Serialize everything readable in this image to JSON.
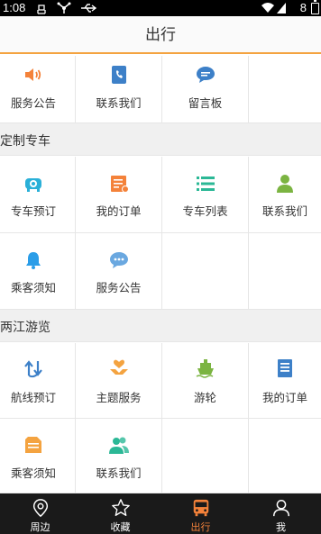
{
  "status_bar": {
    "time": "1:08",
    "battery": "8"
  },
  "header": {
    "title": "出行"
  },
  "top_row": [
    {
      "label": "服务公告",
      "icon": "speaker-icon"
    },
    {
      "label": "联系我们",
      "icon": "contact-phone-icon"
    },
    {
      "label": "留言板",
      "icon": "chat-bubble-icon"
    }
  ],
  "section_custom": {
    "title": "定制专车",
    "row1": [
      {
        "label": "专车预订",
        "icon": "car-icon"
      },
      {
        "label": "我的订单",
        "icon": "order-list-icon"
      },
      {
        "label": "专车列表",
        "icon": "list-icon"
      },
      {
        "label": "联系我们",
        "icon": "person-icon"
      }
    ],
    "row2": [
      {
        "label": "乘客须知",
        "icon": "bell-icon"
      },
      {
        "label": "服务公告",
        "icon": "chat-dots-icon"
      }
    ]
  },
  "section_tour": {
    "title": "两江游览",
    "row1": [
      {
        "label": "航线预订",
        "icon": "route-arrows-icon"
      },
      {
        "label": "主题服务",
        "icon": "heart-hands-icon"
      },
      {
        "label": "游轮",
        "icon": "ship-icon"
      },
      {
        "label": "我的订单",
        "icon": "document-icon"
      }
    ],
    "row2": [
      {
        "label": "乘客须知",
        "icon": "notice-icon"
      },
      {
        "label": "联系我们",
        "icon": "people-icon"
      }
    ]
  },
  "tabbar": [
    {
      "label": "周边",
      "icon": "location-pin-icon"
    },
    {
      "label": "收藏",
      "icon": "star-icon"
    },
    {
      "label": "出行",
      "icon": "bus-icon",
      "active": true
    },
    {
      "label": "我",
      "icon": "user-icon"
    }
  ],
  "colors": {
    "accent": "#f4823a",
    "header_line": "#f4a340"
  }
}
